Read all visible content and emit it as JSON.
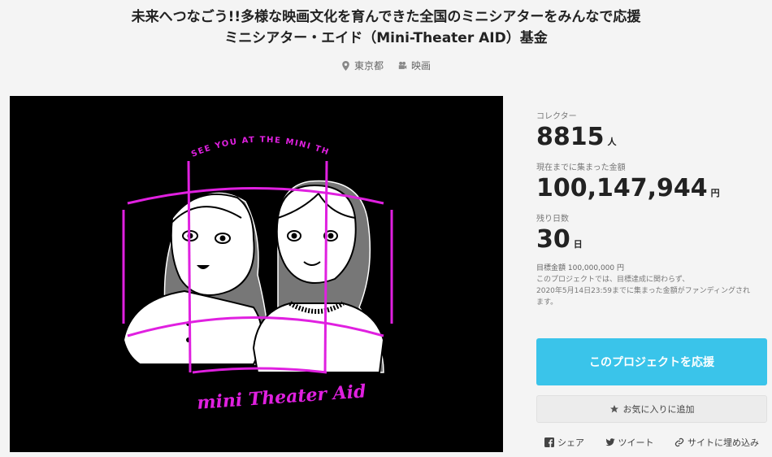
{
  "project": {
    "title_line1": "未来へつなごう!!多様な映画文化を育んできた全国のミニシアターをみんなで応援",
    "title_line2": "ミニシアター・エイド（Mini-Theater AID）基金",
    "location": "東京都",
    "category": "映画",
    "location_icon": "map-pin-icon",
    "category_icon": "movie-camera-icon"
  },
  "hero": {
    "arc_text": "SEE YOU AT THE MINI THEATER.",
    "logo_text": "mini Theater Aid"
  },
  "stats": {
    "collectors_label": "コレクター",
    "collectors_value": "8815",
    "collectors_unit": "人",
    "raised_label": "現在までに集まった金額",
    "raised_value": "100,147,944",
    "raised_unit": "円",
    "days_label": "残り日数",
    "days_value": "30",
    "days_unit": "日"
  },
  "goal": {
    "text": "目標金額 100,000,000 円",
    "note_line1": "このプロジェクトでは、目標達成に関わらず、",
    "note_line2": "2020年5月14日23:59までに集まった金額がファンディングされ",
    "note_line3": "ます。"
  },
  "actions": {
    "support_label": "このプロジェクトを応援",
    "favorite_label": "お気に入りに追加",
    "share_label": "シェア",
    "tweet_label": "ツイート",
    "embed_label": "サイトに埋め込み"
  },
  "colors": {
    "accent": "#3ac4ea",
    "magenta": "#e020e0"
  }
}
